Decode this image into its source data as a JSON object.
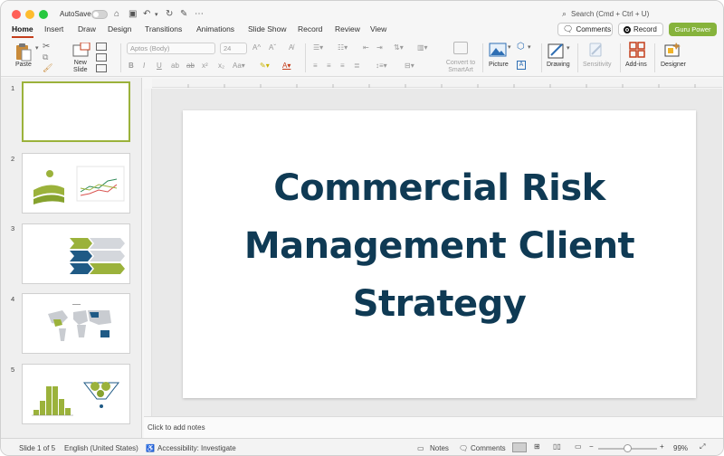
{
  "titlebar": {
    "autosave_label": "AutoSave",
    "search_placeholder": "Search (Cmd + Ctrl + U)"
  },
  "tabs": [
    "Home",
    "Insert",
    "Draw",
    "Design",
    "Transitions",
    "Animations",
    "Slide Show",
    "Record",
    "Review",
    "View"
  ],
  "actions": {
    "comments": "Comments",
    "record": "Record",
    "guru": "Guru Power"
  },
  "ribbon": {
    "paste": "Paste",
    "new_slide_line1": "New",
    "new_slide_line2": "Slide",
    "font_name": "Aptos (Body)",
    "font_size": "24",
    "convert_line1": "Convert to",
    "convert_line2": "SmartArt",
    "picture": "Picture",
    "drawing": "Drawing",
    "sensitivity": "Sensitivity",
    "addins": "Add-ins",
    "designer": "Designer"
  },
  "thumbnails": [
    "1",
    "2",
    "3",
    "4",
    "5"
  ],
  "slide": {
    "title_line1": "Commercial Risk",
    "title_line2": "Management Client",
    "title_line3": "Strategy"
  },
  "notes_placeholder": "Click to add notes",
  "status": {
    "slide_of": "Slide 1 of 5",
    "language": "English (United States)",
    "accessibility": "Accessibility: Investigate",
    "notes": "Notes",
    "comments": "Comments",
    "zoom": "99%"
  },
  "colors": {
    "accent": "#c43e1c",
    "guru_button": "#86b33c",
    "title_text": "#0f3a54",
    "thumb_selected": "#9bb23b"
  }
}
